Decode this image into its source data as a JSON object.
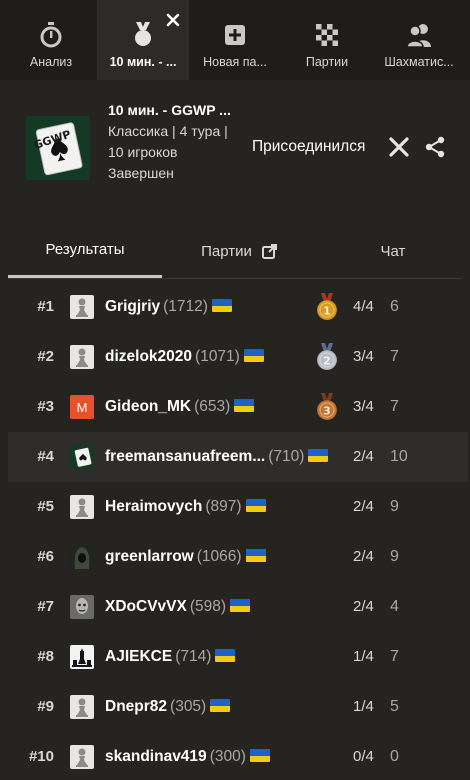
{
  "tabs": [
    {
      "label": "Анализ",
      "icon": "stopwatch-icon"
    },
    {
      "label": "10 мин. - ...",
      "icon": "medal-icon",
      "active": true
    },
    {
      "label": "Новая па...",
      "icon": "plus-square-icon"
    },
    {
      "label": "Партии",
      "icon": "chessboard-icon"
    },
    {
      "label": "Шахматис...",
      "icon": "players-icon"
    }
  ],
  "tournament": {
    "thumbnail_text": "GGWP",
    "title": "10 мин. - GGWP ...",
    "meta_line1": "Классика | 4 тура |",
    "meta_line2": "10 игроков",
    "status": "Завершен",
    "joined_label": "Присоединился"
  },
  "subtabs": [
    {
      "label": "Результаты",
      "active": true
    },
    {
      "label": "Партии"
    },
    {
      "label": "Чат"
    }
  ],
  "colors": {
    "background": "#262421",
    "tabbar": "#1f1d1b",
    "gold": "#d79a1e",
    "silver": "#b9bcc0",
    "bronze": "#c27433",
    "flag_blue": "#1e61c7",
    "flag_yellow": "#f1cc10"
  },
  "results": [
    {
      "rank": "#1",
      "name": "Grigjriy",
      "rating": "(1712)",
      "score": "4/4",
      "points": "6",
      "medal": "gold",
      "avatar": "pawn"
    },
    {
      "rank": "#2",
      "name": "dizelok2020",
      "rating": "(1071)",
      "score": "3/4",
      "points": "7",
      "medal": "silver",
      "avatar": "pawn"
    },
    {
      "rank": "#3",
      "name": "Gideon_MK",
      "rating": "(653)",
      "score": "3/4",
      "points": "7",
      "medal": "bronze",
      "avatar": "letter",
      "avatar_letter": "M"
    },
    {
      "rank": "#4",
      "name": "freemansanuafreem...",
      "rating": "(710)",
      "score": "2/4",
      "points": "10",
      "medal": "",
      "avatar": "cards",
      "highlight": true
    },
    {
      "rank": "#5",
      "name": "Heraimovych",
      "rating": "(897)",
      "score": "2/4",
      "points": "9",
      "medal": "",
      "avatar": "pawn"
    },
    {
      "rank": "#6",
      "name": "greenlarrow",
      "rating": "(1066)",
      "score": "2/4",
      "points": "9",
      "medal": "",
      "avatar": "hood"
    },
    {
      "rank": "#7",
      "name": "XDoCVvVX",
      "rating": "(598)",
      "score": "2/4",
      "points": "4",
      "medal": "",
      "avatar": "face"
    },
    {
      "rank": "#8",
      "name": "AJIEKCE",
      "rating": "(714)",
      "score": "1/4",
      "points": "7",
      "medal": "",
      "avatar": "pieces"
    },
    {
      "rank": "#9",
      "name": "Dnepr82",
      "rating": "(305)",
      "score": "1/4",
      "points": "5",
      "medal": "",
      "avatar": "pawn"
    },
    {
      "rank": "#10",
      "name": "skandinav419",
      "rating": "(300)",
      "score": "0/4",
      "points": "0",
      "medal": "",
      "avatar": "pawn"
    }
  ]
}
